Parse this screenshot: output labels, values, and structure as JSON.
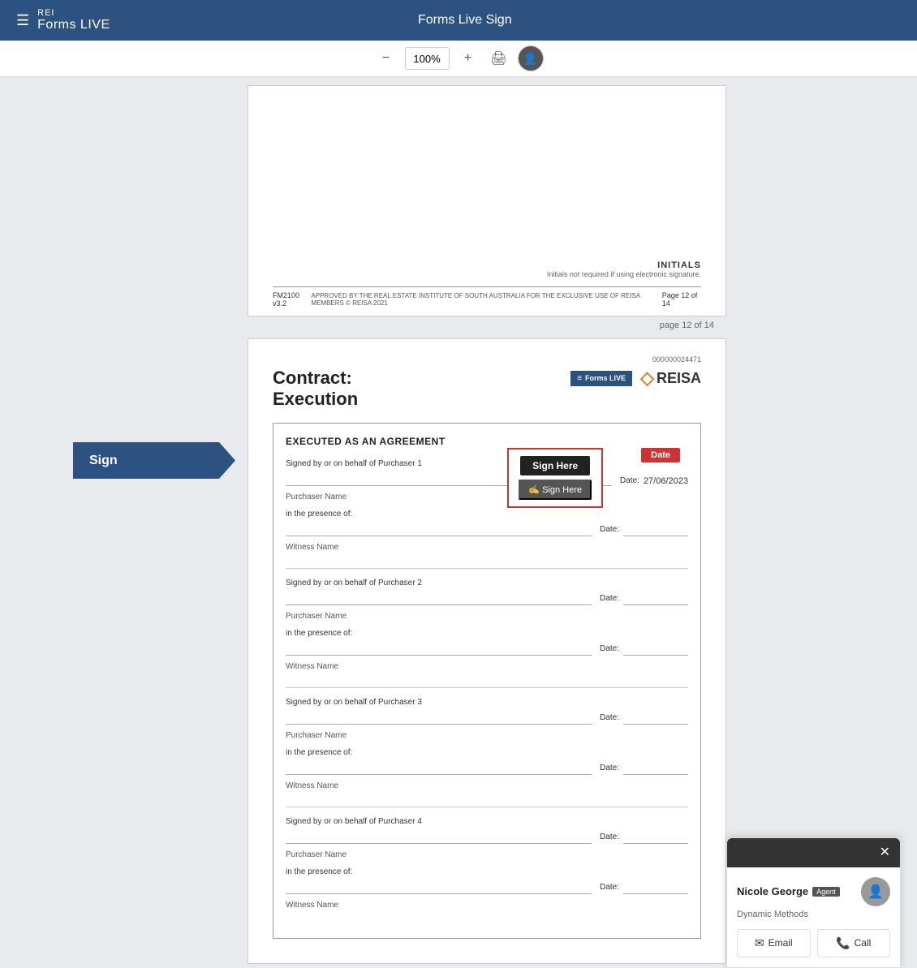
{
  "header": {
    "logo_lines": "≡",
    "brand_name": "REI",
    "brand_sub": "Forms LIVE",
    "page_title": "Forms Live Sign"
  },
  "toolbar": {
    "zoom_out_label": "−",
    "zoom_value": "100%",
    "zoom_in_label": "+",
    "print_label": "🖨",
    "avatar_label": "👤"
  },
  "page12_footer": {
    "form_id": "FM2100",
    "version": "v3.2",
    "approved_text": "APPROVED BY THE REAL ESTATE INSTITUTE OF SOUTH AUSTRALIA FOR THE EXCLUSIVE USE OF REISA MEMBERS © REISA 2021",
    "page_info": "Page 12 of 14"
  },
  "initials": {
    "title": "INITIALS",
    "subtitle": "Initials not required if using electronic signature."
  },
  "page_number": "page 12 of 14",
  "sign_button": "Sign",
  "contract_page": {
    "doc_id": "000000024471",
    "title_line1": "Contract:",
    "title_line2": "Execution",
    "forms_live_badge": "Forms LIVE",
    "reisa_text": "REISA"
  },
  "execution": {
    "section_title": "EXECUTED AS AN AGREEMENT",
    "sign_here_label": "Sign Here",
    "sign_here_btn": "✍ Sign Here",
    "date_badge": "Date",
    "date_value": "27/06/2023",
    "purchasers": [
      {
        "signed_label": "Signed by or on behalf of Purchaser 1",
        "name_label": "Purchaser Name",
        "date_label": "Date:",
        "presence_label": "in the presence of:",
        "witness_label": "Witness Name",
        "witness_date": "Date:"
      },
      {
        "signed_label": "Signed by or on behalf of Purchaser 2",
        "name_label": "Purchaser Name",
        "date_label": "Date:",
        "presence_label": "in the presence of:",
        "witness_label": "Witness Name",
        "witness_date": "Date:"
      },
      {
        "signed_label": "Signed by or on behalf of Purchaser 3",
        "name_label": "Purchaser Name",
        "date_label": "Date:",
        "presence_label": "in the presence of:",
        "witness_label": "Witness Name",
        "witness_date": "Date:"
      },
      {
        "signed_label": "Signed by or on behalf of Purchaser 4",
        "name_label": "Purchaser Name",
        "date_label": "Date:",
        "presence_label": "in the presence of:",
        "witness_label": "Witness Name",
        "witness_date": "Date:"
      }
    ]
  },
  "chat": {
    "agent_name": "Nicole George",
    "agent_badge": "Agent",
    "company": "Dynamic Methods",
    "email_label": "Email",
    "call_label": "Call",
    "close_icon": "✕"
  }
}
